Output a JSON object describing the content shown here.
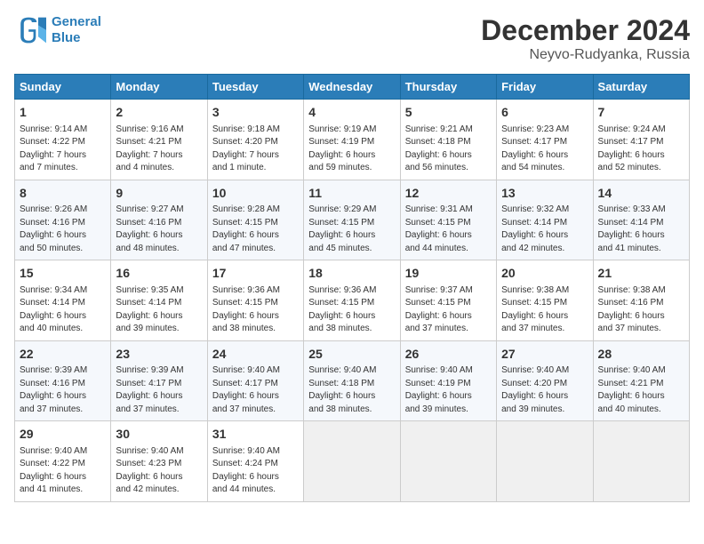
{
  "logo": {
    "line1": "General",
    "line2": "Blue"
  },
  "title": "December 2024",
  "subtitle": "Neyvo-Rudyanka, Russia",
  "days_of_week": [
    "Sunday",
    "Monday",
    "Tuesday",
    "Wednesday",
    "Thursday",
    "Friday",
    "Saturday"
  ],
  "weeks": [
    [
      {
        "day": "1",
        "info": "Sunrise: 9:14 AM\nSunset: 4:22 PM\nDaylight: 7 hours\nand 7 minutes."
      },
      {
        "day": "2",
        "info": "Sunrise: 9:16 AM\nSunset: 4:21 PM\nDaylight: 7 hours\nand 4 minutes."
      },
      {
        "day": "3",
        "info": "Sunrise: 9:18 AM\nSunset: 4:20 PM\nDaylight: 7 hours\nand 1 minute."
      },
      {
        "day": "4",
        "info": "Sunrise: 9:19 AM\nSunset: 4:19 PM\nDaylight: 6 hours\nand 59 minutes."
      },
      {
        "day": "5",
        "info": "Sunrise: 9:21 AM\nSunset: 4:18 PM\nDaylight: 6 hours\nand 56 minutes."
      },
      {
        "day": "6",
        "info": "Sunrise: 9:23 AM\nSunset: 4:17 PM\nDaylight: 6 hours\nand 54 minutes."
      },
      {
        "day": "7",
        "info": "Sunrise: 9:24 AM\nSunset: 4:17 PM\nDaylight: 6 hours\nand 52 minutes."
      }
    ],
    [
      {
        "day": "8",
        "info": "Sunrise: 9:26 AM\nSunset: 4:16 PM\nDaylight: 6 hours\nand 50 minutes."
      },
      {
        "day": "9",
        "info": "Sunrise: 9:27 AM\nSunset: 4:16 PM\nDaylight: 6 hours\nand 48 minutes."
      },
      {
        "day": "10",
        "info": "Sunrise: 9:28 AM\nSunset: 4:15 PM\nDaylight: 6 hours\nand 47 minutes."
      },
      {
        "day": "11",
        "info": "Sunrise: 9:29 AM\nSunset: 4:15 PM\nDaylight: 6 hours\nand 45 minutes."
      },
      {
        "day": "12",
        "info": "Sunrise: 9:31 AM\nSunset: 4:15 PM\nDaylight: 6 hours\nand 44 minutes."
      },
      {
        "day": "13",
        "info": "Sunrise: 9:32 AM\nSunset: 4:14 PM\nDaylight: 6 hours\nand 42 minutes."
      },
      {
        "day": "14",
        "info": "Sunrise: 9:33 AM\nSunset: 4:14 PM\nDaylight: 6 hours\nand 41 minutes."
      }
    ],
    [
      {
        "day": "15",
        "info": "Sunrise: 9:34 AM\nSunset: 4:14 PM\nDaylight: 6 hours\nand 40 minutes."
      },
      {
        "day": "16",
        "info": "Sunrise: 9:35 AM\nSunset: 4:14 PM\nDaylight: 6 hours\nand 39 minutes."
      },
      {
        "day": "17",
        "info": "Sunrise: 9:36 AM\nSunset: 4:15 PM\nDaylight: 6 hours\nand 38 minutes."
      },
      {
        "day": "18",
        "info": "Sunrise: 9:36 AM\nSunset: 4:15 PM\nDaylight: 6 hours\nand 38 minutes."
      },
      {
        "day": "19",
        "info": "Sunrise: 9:37 AM\nSunset: 4:15 PM\nDaylight: 6 hours\nand 37 minutes."
      },
      {
        "day": "20",
        "info": "Sunrise: 9:38 AM\nSunset: 4:15 PM\nDaylight: 6 hours\nand 37 minutes."
      },
      {
        "day": "21",
        "info": "Sunrise: 9:38 AM\nSunset: 4:16 PM\nDaylight: 6 hours\nand 37 minutes."
      }
    ],
    [
      {
        "day": "22",
        "info": "Sunrise: 9:39 AM\nSunset: 4:16 PM\nDaylight: 6 hours\nand 37 minutes."
      },
      {
        "day": "23",
        "info": "Sunrise: 9:39 AM\nSunset: 4:17 PM\nDaylight: 6 hours\nand 37 minutes."
      },
      {
        "day": "24",
        "info": "Sunrise: 9:40 AM\nSunset: 4:17 PM\nDaylight: 6 hours\nand 37 minutes."
      },
      {
        "day": "25",
        "info": "Sunrise: 9:40 AM\nSunset: 4:18 PM\nDaylight: 6 hours\nand 38 minutes."
      },
      {
        "day": "26",
        "info": "Sunrise: 9:40 AM\nSunset: 4:19 PM\nDaylight: 6 hours\nand 39 minutes."
      },
      {
        "day": "27",
        "info": "Sunrise: 9:40 AM\nSunset: 4:20 PM\nDaylight: 6 hours\nand 39 minutes."
      },
      {
        "day": "28",
        "info": "Sunrise: 9:40 AM\nSunset: 4:21 PM\nDaylight: 6 hours\nand 40 minutes."
      }
    ],
    [
      {
        "day": "29",
        "info": "Sunrise: 9:40 AM\nSunset: 4:22 PM\nDaylight: 6 hours\nand 41 minutes."
      },
      {
        "day": "30",
        "info": "Sunrise: 9:40 AM\nSunset: 4:23 PM\nDaylight: 6 hours\nand 42 minutes."
      },
      {
        "day": "31",
        "info": "Sunrise: 9:40 AM\nSunset: 4:24 PM\nDaylight: 6 hours\nand 44 minutes."
      },
      {
        "day": "",
        "info": ""
      },
      {
        "day": "",
        "info": ""
      },
      {
        "day": "",
        "info": ""
      },
      {
        "day": "",
        "info": ""
      }
    ]
  ]
}
